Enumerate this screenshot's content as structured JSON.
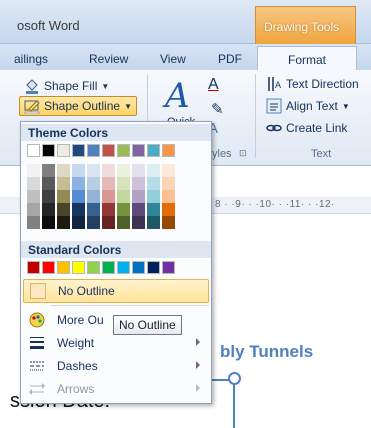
{
  "window": {
    "title": "osoft Word"
  },
  "contextual_tab": {
    "title": "Drawing Tools"
  },
  "tabs": [
    {
      "label": "ailings"
    },
    {
      "label": "Review"
    },
    {
      "label": "View"
    },
    {
      "label": "PDF"
    },
    {
      "label": "Format"
    }
  ],
  "ribbon": {
    "shape_fill": "Shape Fill",
    "shape_outline": "Shape Outline",
    "quick_label": "Quick",
    "styles_label": "yles",
    "text_direction": "Text Direction",
    "align_text": "Align Text",
    "create_link": "Create Link",
    "text_group": "Text"
  },
  "ruler": {
    "text": "8 · ·9· · ·10· · ·11· · ·12·"
  },
  "menu": {
    "theme_colors_header": "Theme Colors",
    "standard_colors_header": "Standard Colors",
    "theme_top_row": [
      "#ffffff",
      "#000000",
      "#eeece1",
      "#1f497d",
      "#4f81bd",
      "#c0504d",
      "#9bbb59",
      "#8064a2",
      "#4bacc6",
      "#f79646"
    ],
    "theme_shades": [
      [
        "#f2f2f2",
        "#d9d9d9",
        "#bfbfbf",
        "#a6a6a6",
        "#808080"
      ],
      [
        "#7f7f7f",
        "#595959",
        "#404040",
        "#262626",
        "#0d0d0d"
      ],
      [
        "#ddd9c3",
        "#c4bd97",
        "#938953",
        "#4a442a",
        "#1d1b10"
      ],
      [
        "#c6d9f0",
        "#8db3e2",
        "#548dd4",
        "#17365d",
        "#0f243e"
      ],
      [
        "#dbe5f1",
        "#b8cce4",
        "#95b3d7",
        "#366092",
        "#244061"
      ],
      [
        "#f2dcdb",
        "#e5b9b7",
        "#d99694",
        "#953734",
        "#632423"
      ],
      [
        "#ebf1dd",
        "#d7e3bc",
        "#c3d69b",
        "#76923c",
        "#4f6128"
      ],
      [
        "#e5e0ec",
        "#ccc1d9",
        "#b2a2c7",
        "#5f497a",
        "#3f3151"
      ],
      [
        "#dbeef3",
        "#b7dde8",
        "#92cddc",
        "#31859b",
        "#205867"
      ],
      [
        "#fdeada",
        "#fbd5b5",
        "#fac08f",
        "#e36c09",
        "#974806"
      ]
    ],
    "standard_row": [
      "#c00000",
      "#ff0000",
      "#ffc000",
      "#ffff00",
      "#92d050",
      "#00b050",
      "#00b0f0",
      "#0070c0",
      "#002060",
      "#7030a0"
    ],
    "items": {
      "no_outline": "No Outline",
      "more_outline_colors": "More Ou",
      "weight": "Weight",
      "dashes": "Dashes",
      "arrows": "Arrows"
    }
  },
  "tooltip": {
    "text": "No Outline"
  },
  "document": {
    "heading": "bly Tunnels",
    "body_text": "ssion Date:"
  }
}
